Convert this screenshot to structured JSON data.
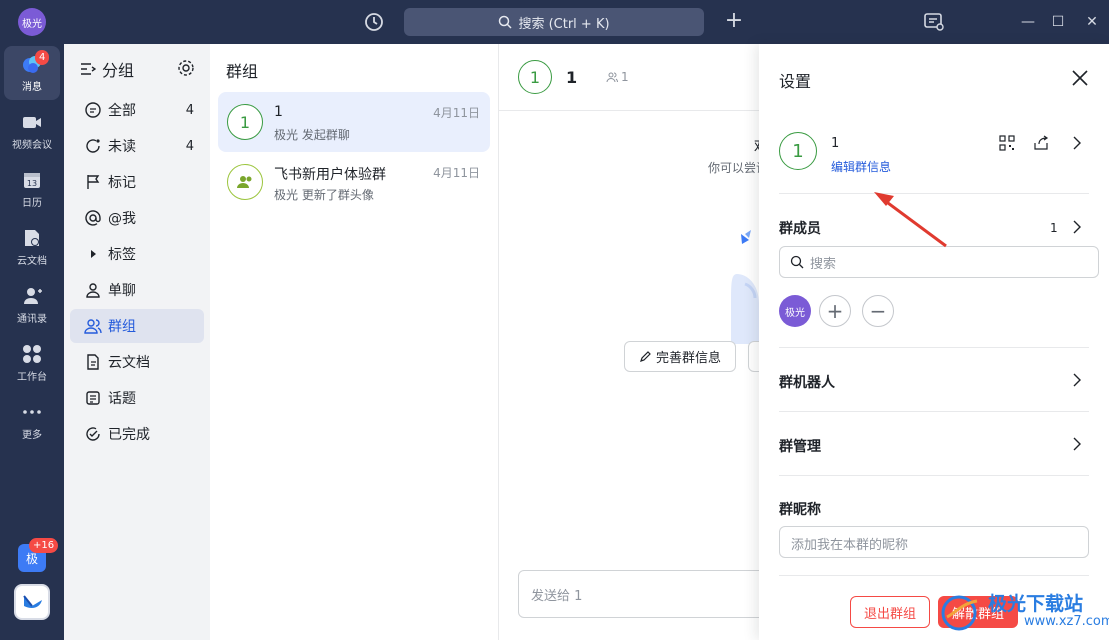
{
  "topbar": {
    "avatar": "极光",
    "search_placeholder": "搜索 (Ctrl + K)"
  },
  "rail": {
    "items": [
      {
        "label": "消息",
        "icon": "chat-bubble-icon",
        "badge": "4",
        "active": true
      },
      {
        "label": "视频会议",
        "icon": "video-camera-icon"
      },
      {
        "label": "日历",
        "icon": "calendar-icon",
        "day": "13"
      },
      {
        "label": "云文档",
        "icon": "cloud-doc-icon"
      },
      {
        "label": "通讯录",
        "icon": "contacts-icon"
      },
      {
        "label": "工作台",
        "icon": "workspace-grid-icon"
      },
      {
        "label": "更多",
        "icon": "more-dots-icon"
      }
    ],
    "bottom_app": {
      "label": "极",
      "badge": "+16"
    }
  },
  "groups": {
    "title": "分组",
    "items": [
      {
        "label": "全部",
        "icon": "chat-all-icon",
        "count": "4"
      },
      {
        "label": "未读",
        "icon": "unread-icon",
        "count": "4"
      },
      {
        "label": "标记",
        "icon": "flag-icon"
      },
      {
        "label": "@我",
        "icon": "at-icon"
      },
      {
        "label": "标签",
        "icon": "caret-right-icon"
      },
      {
        "label": "单聊",
        "icon": "person-icon"
      },
      {
        "label": "群组",
        "icon": "group-icon",
        "active": true
      },
      {
        "label": "云文档",
        "icon": "doc-icon"
      },
      {
        "label": "话题",
        "icon": "topic-icon"
      },
      {
        "label": "已完成",
        "icon": "done-icon"
      }
    ]
  },
  "chatlist": {
    "title": "群组",
    "chats": [
      {
        "avatar": "1",
        "name": "1",
        "sub": "极光 发起群聊",
        "date": "4月11日",
        "active": true
      },
      {
        "avatar": "",
        "name": "飞书新用户体验群",
        "sub": "极光 更新了群头像",
        "date": "4月11日"
      }
    ]
  },
  "conversation": {
    "avatar": "1",
    "name": "1",
    "member_count": "1",
    "welcome": "欢",
    "tip": "你可以尝试",
    "button_label": "完善群信息",
    "input_placeholder": "发送给 1"
  },
  "settings": {
    "title": "设置",
    "group_avatar": "1",
    "group_name": "1",
    "edit_link": "编辑群信息",
    "members_title": "群成员",
    "members_count": "1",
    "members_search_placeholder": "搜索",
    "member_avatar": "极光",
    "bots_title": "群机器人",
    "manage_title": "群管理",
    "nickname_title": "群昵称",
    "nickname_placeholder": "添加我在本群的昵称",
    "leave_button": "退出群组",
    "dissolve_button": "解散群组"
  },
  "watermark": {
    "line1": "极光下载站",
    "line2": "www.xz7.com"
  },
  "colors": {
    "nav_bg": "#26324f",
    "accent": "#245bdb",
    "danger": "#f54a45",
    "group_green": "#3a9b42"
  }
}
